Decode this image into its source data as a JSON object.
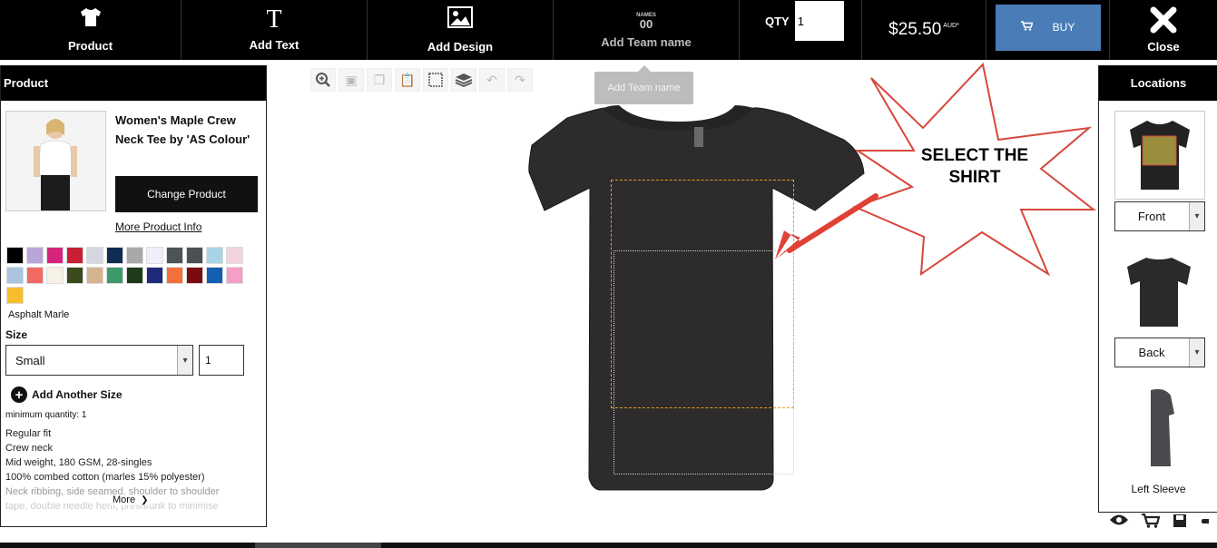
{
  "topbar": {
    "product_label": "Product",
    "add_text_label": "Add Text",
    "add_design_label": "Add Design",
    "add_team_label": "Add Team name",
    "team_icon_top": "NAMES",
    "team_icon_num": "00",
    "qty_label": "QTY",
    "qty_value": "1",
    "price": "$25.50",
    "price_suffix": "AUD*",
    "buy_label": "BUY",
    "close_label": "Close",
    "tooltip": "Add Team name",
    "accent_color": "#4a7db8"
  },
  "product_panel": {
    "header": "Product",
    "product_name": "Women's Maple Crew Neck Tee by 'AS Colour'",
    "change_button": "Change Product",
    "more_info_link": "More Product Info",
    "swatches": [
      "#000000",
      "#b9a5d8",
      "#d6247d",
      "#c81f35",
      "#d5d7e0",
      "#0f2d52",
      "#a8a8a8",
      "#f1edf8",
      "#4e5357",
      "#4c4f54",
      "#a8d4e6",
      "#f3d3dc",
      "#a9c3e0",
      "#f06a63",
      "#f6f1e5",
      "#3a4a1e",
      "#d4b48e",
      "#3e9a6b",
      "#1d3a1a",
      "#1f2a7a",
      "#f3703a",
      "#7a0c10",
      "#1360b0",
      "#f59ec8",
      "#f7bd2d"
    ],
    "selected_color": "Asphalt Marle",
    "size_label": "Size",
    "size_value": "Small",
    "size_qty": "1",
    "add_size": "Add Another Size",
    "min_quantity": "minimum quantity: 1",
    "description": [
      "Regular fit",
      "Crew neck",
      "Mid weight, 180 GSM, 28-singles",
      "100% combed cotton (marles 15% polyester)",
      "Neck ribbing, side seamed, shoulder to shoulder",
      "tape, double needle hem, preshrunk to minimise"
    ],
    "more_link": "More"
  },
  "callout": {
    "text": "SELECT THE SHIRT"
  },
  "locations_panel": {
    "header": "Locations",
    "front_label": "Front",
    "back_label": "Back",
    "left_sleeve_label": "Left Sleeve"
  }
}
